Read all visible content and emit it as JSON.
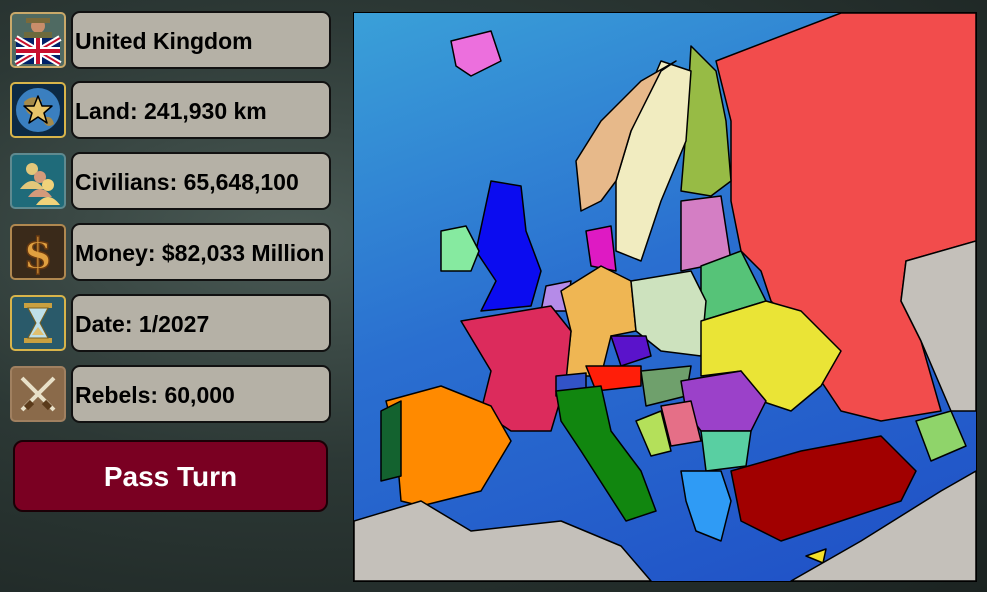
{
  "stats": {
    "country": "United Kingdom",
    "land": "Land: 241,930 km",
    "civilians": "Civilians: 65,648,100",
    "money": "Money: $82,033 Million",
    "date": "Date: 1/2027",
    "rebels": "Rebels: 60,000"
  },
  "icons": [
    "leader-flag-icon",
    "globe-star-icon",
    "civilians-icon",
    "dollar-icon",
    "hourglass-icon",
    "crossed-swords-icon"
  ],
  "pass_turn_label": "Pass Turn",
  "colors": {
    "player": "#0b0cf0",
    "button": "#7a0022",
    "panel": "#b5b1a6",
    "sea": "#2a6fd0"
  }
}
